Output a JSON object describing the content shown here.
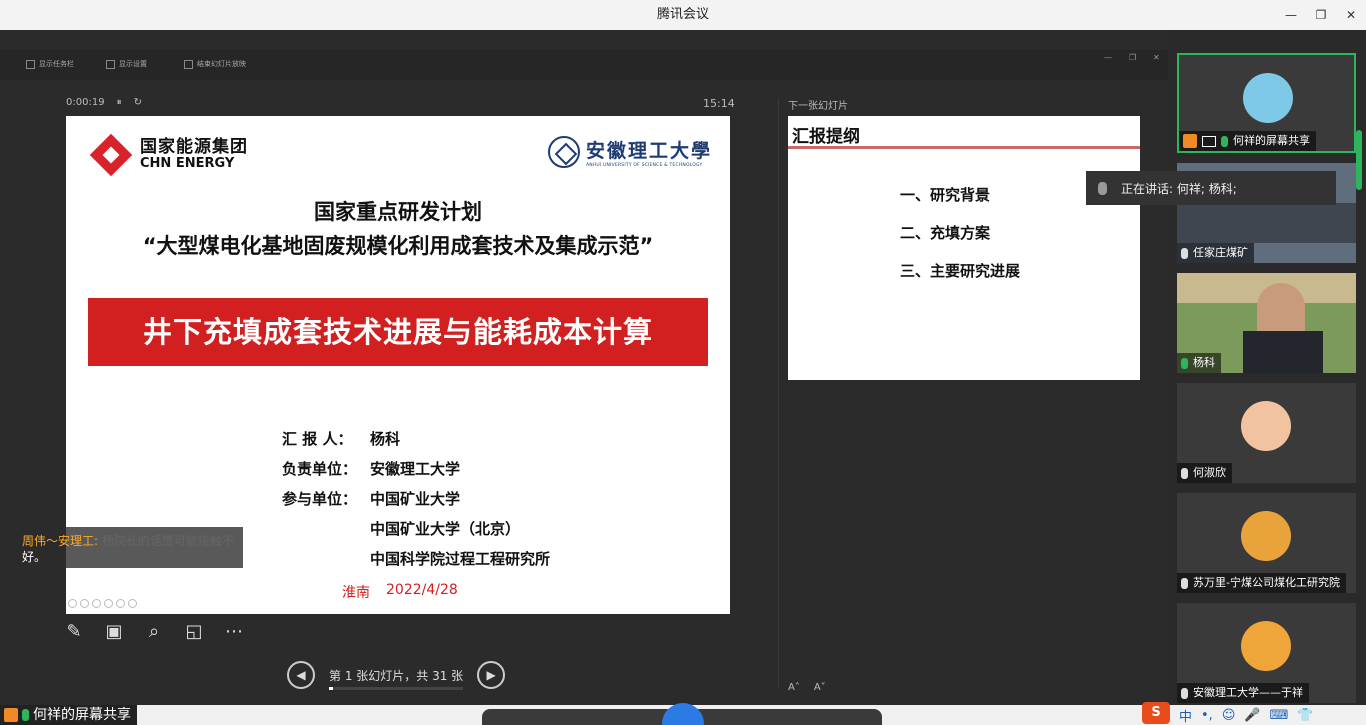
{
  "window": {
    "title": "腾讯会议",
    "minimize": "—",
    "restore": "❐",
    "close": "✕"
  },
  "presenter": {
    "tools": [
      "显示任务栏",
      "显示设置",
      "结束幻灯片放映"
    ],
    "timer": "0:00:19",
    "pause": "⏸",
    "restart": "↻",
    "clock": "15:14",
    "next_label": "下一张幻灯片",
    "counter": "第 1 张幻灯片，共 31 张",
    "progress": 0.032,
    "prev": "◀",
    "next": "▶",
    "font_up": "A˄",
    "font_down": "A˅",
    "tool_icons": [
      "✎",
      "▣",
      "⌕",
      "◱",
      "⋯"
    ]
  },
  "slide": {
    "logo_chn_cn": "国家能源集团",
    "logo_chn_en": "CHN ENERGY",
    "logo_ah_name": "安徽理工大學",
    "logo_ah_en": "ANHUI UNIVERSITY OF SCIENCE & TECHNOLOGY",
    "title1": "国家重点研发计划",
    "title2": "“大型煤电化基地固废规模化利用成套技术及集成示范”",
    "banner": "井下充填成套技术进展与能耗成本计算",
    "info": [
      {
        "label": "汇 报 人：",
        "value": "杨科"
      },
      {
        "label": "负责单位：",
        "value": "安徽理工大学"
      },
      {
        "label": "参与单位：",
        "value": "中国矿业大学"
      },
      {
        "label": "",
        "value": "中国矿业大学（北京）"
      },
      {
        "label": "",
        "value": "中国科学院过程工程研究所"
      }
    ],
    "place": "淮南",
    "date": "2022/4/28"
  },
  "next_slide": {
    "title": "汇报提纲",
    "items": [
      "一、研究背景",
      "二、充填方案",
      "三、主要研究进展"
    ]
  },
  "subtitle": {
    "speaker": "周伟～安理工:",
    "text": "杨院长的话筒可能接触不",
    "text2": "好。"
  },
  "speaking": "正在讲话: 何祥; 杨科;",
  "participants": [
    {
      "name": "何祥的屏幕共享",
      "avatar_color": "#7fc9e8",
      "active": true,
      "sharing": true
    },
    {
      "name": "任家庄煤矿",
      "avatar_color": "#556070",
      "video": true
    },
    {
      "name": "杨科",
      "avatar_color": "#6b8a55",
      "video": true
    },
    {
      "name": "何淑欣",
      "avatar_color": "#f2c3a0"
    },
    {
      "name": "苏万里-宁煤公司煤化工研究院",
      "avatar_color": "#e8a33b"
    },
    {
      "name": "安徽理工大学——于祥",
      "avatar_color": "#f0a53a"
    }
  ],
  "taskbar": {
    "label": "何祥的屏幕共享",
    "ime": [
      "S",
      "中",
      "•,",
      "☺",
      "🎤",
      "⌨",
      "👕"
    ]
  }
}
